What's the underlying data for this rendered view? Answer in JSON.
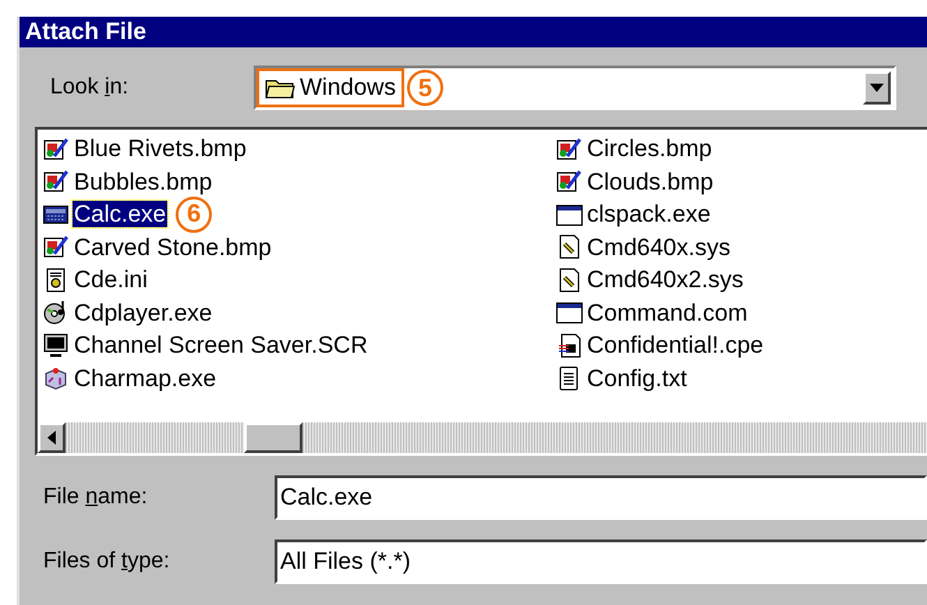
{
  "window": {
    "title": "Attach File"
  },
  "look_in": {
    "label_parts": [
      "Look ",
      "i",
      "n:"
    ],
    "value": "Windows",
    "callout": "5"
  },
  "files": [
    {
      "name": "Blue Rivets.bmp",
      "kind": "paint",
      "selected": false
    },
    {
      "name": "Bubbles.bmp",
      "kind": "paint",
      "selected": false
    },
    {
      "name": "Calc.exe",
      "kind": "calc",
      "selected": true,
      "callout": "6"
    },
    {
      "name": "Carved Stone.bmp",
      "kind": "paint",
      "selected": false
    },
    {
      "name": "Cde.ini",
      "kind": "ini",
      "selected": false
    },
    {
      "name": "Cdplayer.exe",
      "kind": "cd",
      "selected": false
    },
    {
      "name": "Channel Screen Saver.SCR",
      "kind": "monitor",
      "selected": false
    },
    {
      "name": "Charmap.exe",
      "kind": "charmap",
      "selected": false
    },
    {
      "name": "Circles.bmp",
      "kind": "paint",
      "selected": false
    },
    {
      "name": "Clouds.bmp",
      "kind": "paint",
      "selected": false
    },
    {
      "name": "clspack.exe",
      "kind": "program",
      "selected": false
    },
    {
      "name": "Cmd640x.sys",
      "kind": "sys",
      "selected": false
    },
    {
      "name": "Cmd640x2.sys",
      "kind": "sys",
      "selected": false
    },
    {
      "name": "Command.com",
      "kind": "program",
      "selected": false
    },
    {
      "name": "Confidential!.cpe",
      "kind": "cpe",
      "selected": false
    },
    {
      "name": "Config.txt",
      "kind": "txt",
      "selected": false
    }
  ],
  "file_name": {
    "label_parts": [
      "File ",
      "n",
      "ame:"
    ],
    "value": "Calc.exe"
  },
  "file_type": {
    "label_parts": [
      "Files of ",
      "t",
      "ype:"
    ],
    "value": "All Files (*.*)"
  }
}
